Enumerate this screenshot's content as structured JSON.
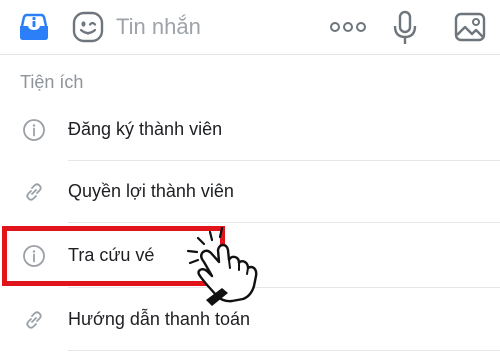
{
  "topbar": {
    "placeholder": "Tin nhắn",
    "icons": [
      "inbox-icon",
      "sticker-icon",
      "more-icon",
      "microphone-icon",
      "image-icon"
    ]
  },
  "section": {
    "title": "Tiện ích"
  },
  "menu": {
    "items": [
      {
        "label": "Đăng ký thành viên",
        "icon": "info-icon"
      },
      {
        "label": "Quyền lợi thành viên",
        "icon": "link-icon"
      },
      {
        "label": "Tra cứu vé",
        "icon": "info-icon"
      },
      {
        "label": "Hướng dẫn thanh toán",
        "icon": "link-icon"
      }
    ]
  },
  "colors": {
    "accent": "#2d7ff9",
    "highlight": "#e1141c",
    "icon_gray": "#9aa0a6",
    "text": "#1d1f22"
  }
}
